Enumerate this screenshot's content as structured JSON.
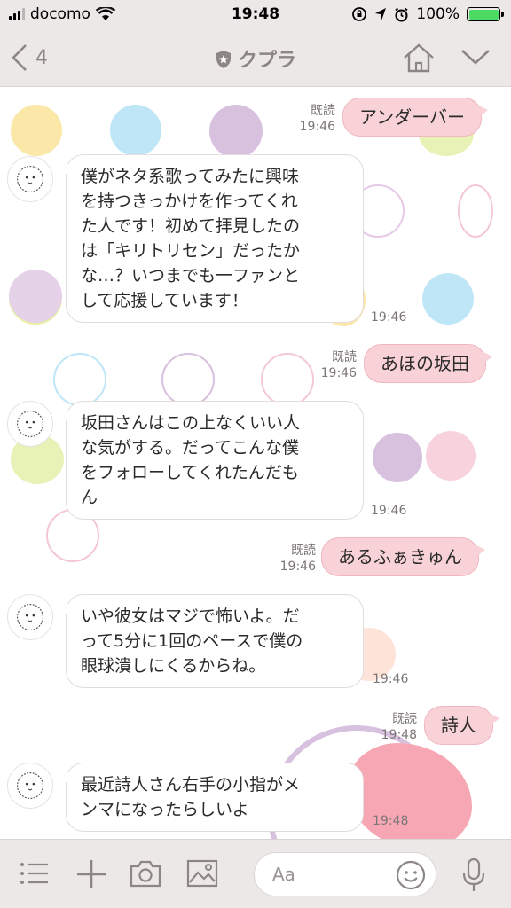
{
  "status_bar": {
    "carrier": "docomo",
    "time": "19:48",
    "battery_percent": "100%",
    "icons": [
      "signal-icon",
      "wifi-icon",
      "lock-rotation-icon",
      "location-icon",
      "alarm-icon",
      "battery-icon"
    ]
  },
  "nav": {
    "back_count": "4",
    "title": "クプラ",
    "icons": [
      "back-chevron-icon",
      "shield-icon",
      "home-icon",
      "chevron-down-icon"
    ]
  },
  "messages": [
    {
      "direction": "out",
      "text": "アンダーバー",
      "read": "既読",
      "time": "19:46"
    },
    {
      "direction": "in",
      "lines": [
        "僕がネタ系歌ってみたに興味",
        "を持つきっかけを作ってくれ",
        "た人です！初めて拝見したの",
        "は「キリトリセン」だったか",
        "な…？いつまでも一ファンと",
        "して応援しています！"
      ],
      "time": "19:46"
    },
    {
      "direction": "out",
      "text": "あほの坂田",
      "read": "既読",
      "time": "19:46"
    },
    {
      "direction": "in",
      "lines": [
        "坂田さんはこの上なくいい人",
        "な気がする。だってこんな僕",
        "をフォローしてくれたんだも",
        "ん"
      ],
      "time": "19:46"
    },
    {
      "direction": "out",
      "text": "あるふぁきゅん",
      "read": "既読",
      "time": "19:46"
    },
    {
      "direction": "in",
      "lines": [
        "いや彼女はマジで怖いよ。だ",
        "って5分に1回のペースで僕の",
        "眼球潰しにくるからね。"
      ],
      "time": "19:46"
    },
    {
      "direction": "out",
      "text": "詩人",
      "read": "既読",
      "time": "19:48"
    },
    {
      "direction": "in",
      "lines": [
        "最近詩人さん右手の小指がメ",
        "ンマになったらしいよ"
      ],
      "time": "19:48"
    }
  ],
  "composer": {
    "placeholder": "Aa",
    "icons": [
      "menu-icon",
      "plus-icon",
      "camera-icon",
      "image-icon",
      "emoji-icon",
      "mic-icon"
    ]
  },
  "colors": {
    "bar_bg": "#ece8e8",
    "outgoing_bubble": "#f8d2d7",
    "incoming_bubble": "#ffffff",
    "battery_green": "#4cd964"
  }
}
